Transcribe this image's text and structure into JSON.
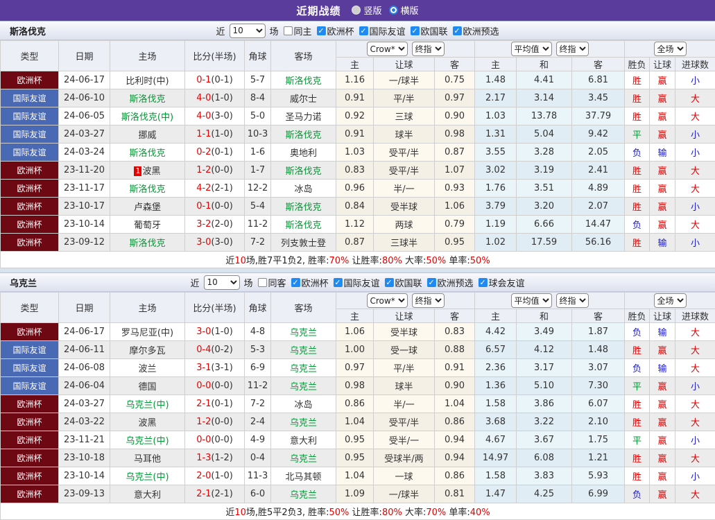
{
  "title_bar": {
    "title": "近期战绩",
    "layout_options": [
      {
        "label": "竖版",
        "checked": false
      },
      {
        "label": "横版",
        "checked": true
      }
    ]
  },
  "colors": {
    "header_bar": "#5a3c9d",
    "checkbox_accent": "#1f8bf2",
    "team_highlight": "#009933",
    "type_colors": {
      "欧洲杯": "#6e0812",
      "国际友谊": "#4a69b5"
    },
    "result_colors": {
      "胜": "#e00000",
      "平": "#009933",
      "负": "#1a1acc",
      "赢": "#e00000",
      "输": "#1a1acc",
      "大": "#e00000",
      "小": "#1a1acc"
    }
  },
  "table_header": {
    "static_cols": [
      "类型",
      "日期",
      "主场",
      "比分(半场)",
      "角球",
      "客场"
    ],
    "groups": [
      {
        "selects": [
          "Crow*",
          "终指"
        ],
        "cols": [
          "主",
          "让球",
          "客"
        ]
      },
      {
        "selects": [
          "平均值",
          "终指"
        ],
        "cols": [
          "主",
          "和",
          "客"
        ]
      },
      {
        "selects": [
          "全场"
        ],
        "cols": [
          "胜负",
          "让球",
          "进球数"
        ]
      }
    ]
  },
  "sections": [
    {
      "team": "斯洛伐克",
      "filters": {
        "prefix": "近",
        "count": "10",
        "suffix": "场",
        "same_venue": {
          "label": "同主",
          "checked": false
        },
        "leagues": [
          {
            "label": "欧洲杯",
            "checked": true
          },
          {
            "label": "国际友谊",
            "checked": true
          },
          {
            "label": "欧国联",
            "checked": true
          },
          {
            "label": "欧洲预选",
            "checked": true
          }
        ]
      },
      "rows": [
        {
          "type": "欧洲杯",
          "date": "24-06-17",
          "badge": "",
          "home": "比利时(中)",
          "home_active": false,
          "score": "0-1",
          "half": "(0-1)",
          "corners": "5-7",
          "away": "斯洛伐克",
          "away_active": true,
          "crow": [
            "1.16",
            "一/球半",
            "0.75"
          ],
          "avg": [
            "1.48",
            "4.41",
            "6.81"
          ],
          "results": [
            "胜",
            "赢",
            "小"
          ]
        },
        {
          "type": "国际友谊",
          "date": "24-06-10",
          "badge": "",
          "home": "斯洛伐克",
          "home_active": true,
          "score": "4-0",
          "half": "(1-0)",
          "corners": "8-4",
          "away": "威尔士",
          "away_active": false,
          "crow": [
            "0.91",
            "平/半",
            "0.97"
          ],
          "avg": [
            "2.17",
            "3.14",
            "3.45"
          ],
          "results": [
            "胜",
            "赢",
            "大"
          ]
        },
        {
          "type": "国际友谊",
          "date": "24-06-05",
          "badge": "",
          "home": "斯洛伐克(中)",
          "home_active": true,
          "score": "4-0",
          "half": "(3-0)",
          "corners": "5-0",
          "away": "圣马力诺",
          "away_active": false,
          "crow": [
            "0.92",
            "三球",
            "0.90"
          ],
          "avg": [
            "1.03",
            "13.78",
            "37.79"
          ],
          "results": [
            "胜",
            "赢",
            "大"
          ]
        },
        {
          "type": "国际友谊",
          "date": "24-03-27",
          "badge": "",
          "home": "挪威",
          "home_active": false,
          "score": "1-1",
          "half": "(1-0)",
          "corners": "10-3",
          "away": "斯洛伐克",
          "away_active": true,
          "crow": [
            "0.91",
            "球半",
            "0.98"
          ],
          "avg": [
            "1.31",
            "5.04",
            "9.42"
          ],
          "results": [
            "平",
            "赢",
            "小"
          ]
        },
        {
          "type": "国际友谊",
          "date": "24-03-24",
          "badge": "",
          "home": "斯洛伐克",
          "home_active": true,
          "score": "0-2",
          "half": "(0-1)",
          "corners": "1-6",
          "away": "奥地利",
          "away_active": false,
          "crow": [
            "1.03",
            "受平/半",
            "0.87"
          ],
          "avg": [
            "3.55",
            "3.28",
            "2.05"
          ],
          "results": [
            "负",
            "输",
            "小"
          ]
        },
        {
          "type": "欧洲杯",
          "date": "23-11-20",
          "badge": "1",
          "home": "波黑",
          "home_active": false,
          "score": "1-2",
          "half": "(0-0)",
          "corners": "1-7",
          "away": "斯洛伐克",
          "away_active": true,
          "crow": [
            "0.83",
            "受平/半",
            "1.07"
          ],
          "avg": [
            "3.02",
            "3.19",
            "2.41"
          ],
          "results": [
            "胜",
            "赢",
            "大"
          ]
        },
        {
          "type": "欧洲杯",
          "date": "23-11-17",
          "badge": "",
          "home": "斯洛伐克",
          "home_active": true,
          "score": "4-2",
          "half": "(2-1)",
          "corners": "12-2",
          "away": "冰岛",
          "away_active": false,
          "crow": [
            "0.96",
            "半/一",
            "0.93"
          ],
          "avg": [
            "1.76",
            "3.51",
            "4.89"
          ],
          "results": [
            "胜",
            "赢",
            "大"
          ]
        },
        {
          "type": "欧洲杯",
          "date": "23-10-17",
          "badge": "",
          "home": "卢森堡",
          "home_active": false,
          "score": "0-1",
          "half": "(0-0)",
          "corners": "5-4",
          "away": "斯洛伐克",
          "away_active": true,
          "crow": [
            "0.84",
            "受半球",
            "1.06"
          ],
          "avg": [
            "3.79",
            "3.20",
            "2.07"
          ],
          "results": [
            "胜",
            "赢",
            "小"
          ]
        },
        {
          "type": "欧洲杯",
          "date": "23-10-14",
          "badge": "",
          "home": "葡萄牙",
          "home_active": false,
          "score": "3-2",
          "half": "(2-0)",
          "corners": "11-2",
          "away": "斯洛伐克",
          "away_active": true,
          "crow": [
            "1.12",
            "两球",
            "0.79"
          ],
          "avg": [
            "1.19",
            "6.66",
            "14.47"
          ],
          "results": [
            "负",
            "赢",
            "大"
          ]
        },
        {
          "type": "欧洲杯",
          "date": "23-09-12",
          "badge": "",
          "home": "斯洛伐克",
          "home_active": true,
          "score": "3-0",
          "half": "(3-0)",
          "corners": "7-2",
          "away": "列支敦士登",
          "away_active": false,
          "crow": [
            "0.87",
            "三球半",
            "0.95"
          ],
          "avg": [
            "1.02",
            "17.59",
            "56.16"
          ],
          "results": [
            "胜",
            "输",
            "小"
          ]
        }
      ],
      "summary": [
        {
          "text": "近",
          "red": false
        },
        {
          "text": "10",
          "red": true
        },
        {
          "text": "场,胜7平1负2, 胜率:",
          "red": false
        },
        {
          "text": "70%",
          "red": true
        },
        {
          "text": " 让胜率:",
          "red": false
        },
        {
          "text": "80%",
          "red": true
        },
        {
          "text": " 大率:",
          "red": false
        },
        {
          "text": "50%",
          "red": true
        },
        {
          "text": " 单率:",
          "red": false
        },
        {
          "text": "50%",
          "red": true
        }
      ]
    },
    {
      "team": "乌克兰",
      "filters": {
        "prefix": "近",
        "count": "10",
        "suffix": "场",
        "same_venue": {
          "label": "同客",
          "checked": false
        },
        "leagues": [
          {
            "label": "欧洲杯",
            "checked": true
          },
          {
            "label": "国际友谊",
            "checked": true
          },
          {
            "label": "欧国联",
            "checked": true
          },
          {
            "label": "欧洲预选",
            "checked": true
          },
          {
            "label": "球会友谊",
            "checked": true
          }
        ]
      },
      "rows": [
        {
          "type": "欧洲杯",
          "date": "24-06-17",
          "badge": "",
          "home": "罗马尼亚(中)",
          "home_active": false,
          "score": "3-0",
          "half": "(1-0)",
          "corners": "4-8",
          "away": "乌克兰",
          "away_active": true,
          "crow": [
            "1.06",
            "受半球",
            "0.83"
          ],
          "avg": [
            "4.42",
            "3.49",
            "1.87"
          ],
          "results": [
            "负",
            "输",
            "大"
          ]
        },
        {
          "type": "国际友谊",
          "date": "24-06-11",
          "badge": "",
          "home": "摩尔多瓦",
          "home_active": false,
          "score": "0-4",
          "half": "(0-2)",
          "corners": "5-3",
          "away": "乌克兰",
          "away_active": true,
          "crow": [
            "1.00",
            "受一球",
            "0.88"
          ],
          "avg": [
            "6.57",
            "4.12",
            "1.48"
          ],
          "results": [
            "胜",
            "赢",
            "大"
          ]
        },
        {
          "type": "国际友谊",
          "date": "24-06-08",
          "badge": "",
          "home": "波兰",
          "home_active": false,
          "score": "3-1",
          "half": "(3-1)",
          "corners": "6-9",
          "away": "乌克兰",
          "away_active": true,
          "crow": [
            "0.97",
            "平/半",
            "0.91"
          ],
          "avg": [
            "2.36",
            "3.17",
            "3.07"
          ],
          "results": [
            "负",
            "输",
            "大"
          ]
        },
        {
          "type": "国际友谊",
          "date": "24-06-04",
          "badge": "",
          "home": "德国",
          "home_active": false,
          "score": "0-0",
          "half": "(0-0)",
          "corners": "11-2",
          "away": "乌克兰",
          "away_active": true,
          "crow": [
            "0.98",
            "球半",
            "0.90"
          ],
          "avg": [
            "1.36",
            "5.10",
            "7.30"
          ],
          "results": [
            "平",
            "赢",
            "小"
          ]
        },
        {
          "type": "欧洲杯",
          "date": "24-03-27",
          "badge": "",
          "home": "乌克兰(中)",
          "home_active": true,
          "score": "2-1",
          "half": "(0-1)",
          "corners": "7-2",
          "away": "冰岛",
          "away_active": false,
          "crow": [
            "0.86",
            "半/一",
            "1.04"
          ],
          "avg": [
            "1.58",
            "3.86",
            "6.07"
          ],
          "results": [
            "胜",
            "赢",
            "大"
          ]
        },
        {
          "type": "欧洲杯",
          "date": "24-03-22",
          "badge": "",
          "home": "波黑",
          "home_active": false,
          "score": "1-2",
          "half": "(0-0)",
          "corners": "2-4",
          "away": "乌克兰",
          "away_active": true,
          "crow": [
            "1.04",
            "受平/半",
            "0.86"
          ],
          "avg": [
            "3.68",
            "3.22",
            "2.10"
          ],
          "results": [
            "胜",
            "赢",
            "大"
          ]
        },
        {
          "type": "欧洲杯",
          "date": "23-11-21",
          "badge": "",
          "home": "乌克兰(中)",
          "home_active": true,
          "score": "0-0",
          "half": "(0-0)",
          "corners": "4-9",
          "away": "意大利",
          "away_active": false,
          "crow": [
            "0.95",
            "受半/一",
            "0.94"
          ],
          "avg": [
            "4.67",
            "3.67",
            "1.75"
          ],
          "results": [
            "平",
            "赢",
            "小"
          ]
        },
        {
          "type": "欧洲杯",
          "date": "23-10-18",
          "badge": "",
          "home": "马耳他",
          "home_active": false,
          "score": "1-3",
          "half": "(1-2)",
          "corners": "0-4",
          "away": "乌克兰",
          "away_active": true,
          "crow": [
            "0.95",
            "受球半/两",
            "0.94"
          ],
          "avg": [
            "14.97",
            "6.08",
            "1.21"
          ],
          "results": [
            "胜",
            "赢",
            "大"
          ]
        },
        {
          "type": "欧洲杯",
          "date": "23-10-14",
          "badge": "",
          "home": "乌克兰(中)",
          "home_active": true,
          "score": "2-0",
          "half": "(1-0)",
          "corners": "11-3",
          "away": "北马其顿",
          "away_active": false,
          "crow": [
            "1.04",
            "一球",
            "0.86"
          ],
          "avg": [
            "1.58",
            "3.83",
            "5.93"
          ],
          "results": [
            "胜",
            "赢",
            "小"
          ]
        },
        {
          "type": "欧洲杯",
          "date": "23-09-13",
          "badge": "",
          "home": "意大利",
          "home_active": false,
          "score": "2-1",
          "half": "(2-1)",
          "corners": "6-0",
          "away": "乌克兰",
          "away_active": true,
          "crow": [
            "1.09",
            "一/球半",
            "0.81"
          ],
          "avg": [
            "1.47",
            "4.25",
            "6.99"
          ],
          "results": [
            "负",
            "赢",
            "大"
          ]
        }
      ],
      "summary": [
        {
          "text": "近",
          "red": false
        },
        {
          "text": "10",
          "red": true
        },
        {
          "text": "场,胜5平2负3, 胜率:",
          "red": false
        },
        {
          "text": "50%",
          "red": true
        },
        {
          "text": " 让胜率:",
          "red": false
        },
        {
          "text": "80%",
          "red": true
        },
        {
          "text": " 大率:",
          "red": false
        },
        {
          "text": "70%",
          "red": true
        },
        {
          "text": " 单率:",
          "red": false
        },
        {
          "text": "40%",
          "red": true
        }
      ]
    }
  ]
}
